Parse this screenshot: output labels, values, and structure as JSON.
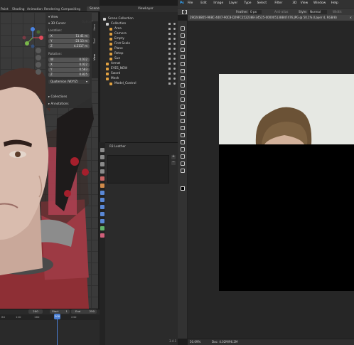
{
  "blender": {
    "menu": [
      "Paint",
      "Shading",
      "Animation",
      "Rendering",
      "Compositing"
    ],
    "scene_label": "Scene",
    "view_layer_label": "ViewLayer",
    "options_label": "Options",
    "npanel": {
      "view_header": "View",
      "cursor_header": "3D Cursor",
      "location_label": "Location:",
      "location": [
        {
          "axis": "X",
          "value": "11.41 m"
        },
        {
          "axis": "Y",
          "value": "-23.13 m"
        },
        {
          "axis": "Z",
          "value": "4.2117 m"
        }
      ],
      "rotation_label": "Rotation:",
      "rotation": [
        {
          "axis": "W",
          "value": "0.032"
        },
        {
          "axis": "X",
          "value": "0.022"
        },
        {
          "axis": "Y",
          "value": "0.583"
        },
        {
          "axis": "Z",
          "value": "0.825"
        }
      ],
      "rotation_mode": "Quaternion (WXYZ)",
      "collections_header": "Collections",
      "annotations_header": "Annotations"
    },
    "side_tabs": [
      "Item",
      "Tool",
      "View"
    ],
    "timeline": {
      "current_frame": "200",
      "start_label": "Start",
      "start_value": "1",
      "end_label": "End",
      "end_value": "250",
      "ruler": [
        "80",
        "120",
        "160",
        "200",
        "240"
      ]
    },
    "outliner": {
      "header": "Scene Collection",
      "items": [
        {
          "label": "Collection",
          "color": "#cfcfcf",
          "indent": 0
        },
        {
          "label": "Area",
          "color": "#e0a040",
          "indent": 1
        },
        {
          "label": "Camera",
          "color": "#e0a040",
          "indent": 1
        },
        {
          "label": "Empty",
          "color": "#e0a040",
          "indent": 1
        },
        {
          "label": "First Scale",
          "color": "#e0a040",
          "indent": 1
        },
        {
          "label": "Plane",
          "color": "#e0a040",
          "indent": 1
        },
        {
          "label": "Retop",
          "color": "#e0a040",
          "indent": 1
        },
        {
          "label": "Sun",
          "color": "#e0a040",
          "indent": 1
        },
        {
          "label": "Armat",
          "color": "#e0a040",
          "indent": 0
        },
        {
          "label": "EYES_NEW",
          "color": "#e0a040",
          "indent": 0
        },
        {
          "label": "Sword",
          "color": "#e0a040",
          "indent": 0
        },
        {
          "label": "Mesh",
          "color": "#e0a040",
          "indent": 0
        },
        {
          "label": "Model_Control",
          "color": "#e0a040",
          "indent": 1
        }
      ]
    },
    "properties": {
      "material_name": "R3 Leather"
    },
    "version": "3.4.1"
  },
  "photoshop": {
    "menu": [
      "File",
      "Edit",
      "Image",
      "Layer",
      "Type",
      "Select",
      "Filter",
      "3D",
      "View",
      "Window",
      "Help"
    ],
    "options": {
      "feather_label": "Feather:",
      "feather_value": "0 px",
      "antialias": "Anti-alias",
      "style_label": "Style:",
      "style_value": "Normal",
      "width_label": "Width:"
    },
    "doc_tab": "290248805-968C-4407-90C8-D29FC252238B-34525-00000513BB47476.JPG @ 50.1% (Layer 4, RGB/8)",
    "zoom": "50.09%",
    "doc_info": "Doc: 4.02M/96.2M",
    "colors": {
      "canvas_bg": "#262626",
      "doc_top": "#e6e8e3",
      "doc_fill": "#000000",
      "hair": "#6b5236"
    }
  }
}
